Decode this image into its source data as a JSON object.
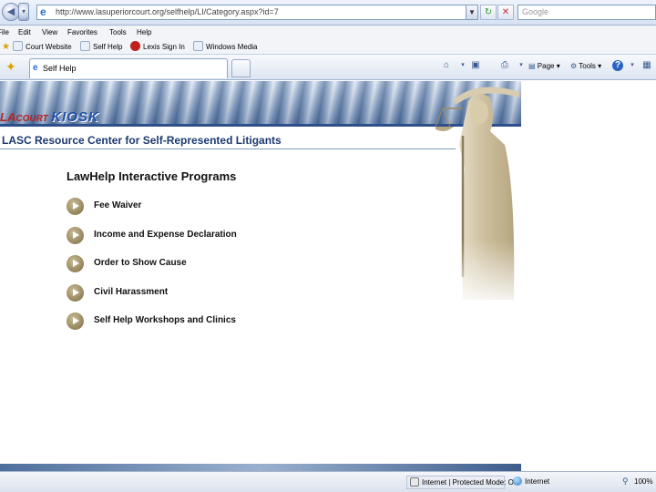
{
  "browser": {
    "address": "http://www.lasuperiorcourt.org/selfhelp/LI/Category.aspx?id=7",
    "search_placeholder": "Google",
    "menu": [
      "File",
      "Edit",
      "View",
      "Favorites",
      "Tools",
      "Help"
    ],
    "favorites": [
      "Court Website",
      "Self Help",
      "Lexis Sign In",
      "Windows Media"
    ],
    "tab_title": "Self Help",
    "commands": {
      "page": "Page",
      "tools": "Tools"
    },
    "status": {
      "zone": "Internet | Protected Mode: Off",
      "internet": "Internet",
      "zoom": "100%"
    }
  },
  "site": {
    "logo_prefix": "LA",
    "logo_court": "COURT",
    "logo_kiosk": "KIOSK",
    "title": "LASC Resource Center for Self-Represented Litigants",
    "heading": "LawHelp Interactive Programs",
    "programs": [
      "Fee Waiver",
      "Income and Expense Declaration",
      "Order to Show Cause",
      "Civil Harassment",
      "Self Help Workshops and Clinics"
    ]
  }
}
